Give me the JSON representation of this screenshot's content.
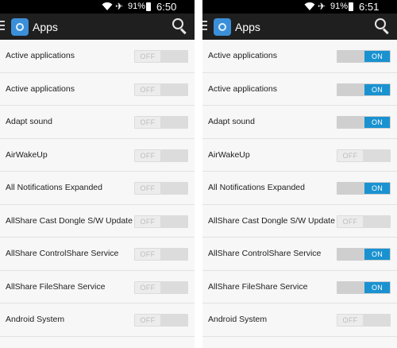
{
  "screens": [
    {
      "status": {
        "battery": "91%",
        "time": "6:50 PM"
      },
      "header": {
        "title": "Apps"
      },
      "apps": [
        {
          "name": "Active applications",
          "toggle": "OFF",
          "enabled": false
        },
        {
          "name": "Active applications",
          "toggle": "OFF",
          "enabled": false
        },
        {
          "name": "Adapt sound",
          "toggle": "OFF",
          "enabled": false
        },
        {
          "name": "AirWakeUp",
          "toggle": "OFF",
          "enabled": false
        },
        {
          "name": "All Notifications Expanded",
          "toggle": "OFF",
          "enabled": false
        },
        {
          "name": "AllShare Cast Dongle S/W Update",
          "toggle": "OFF",
          "enabled": false
        },
        {
          "name": "AllShare ControlShare Service",
          "toggle": "OFF",
          "enabled": false
        },
        {
          "name": "AllShare FileShare Service",
          "toggle": "OFF",
          "enabled": false
        },
        {
          "name": "Android System",
          "toggle": "OFF",
          "enabled": false
        }
      ]
    },
    {
      "status": {
        "battery": "91%",
        "time": "6:51 PM"
      },
      "header": {
        "title": "Apps"
      },
      "apps": [
        {
          "name": "Active applications",
          "toggle": "ON",
          "enabled": true
        },
        {
          "name": "Active applications",
          "toggle": "ON",
          "enabled": true
        },
        {
          "name": "Adapt sound",
          "toggle": "ON",
          "enabled": true
        },
        {
          "name": "AirWakeUp",
          "toggle": "OFF",
          "enabled": false
        },
        {
          "name": "All Notifications Expanded",
          "toggle": "ON",
          "enabled": true
        },
        {
          "name": "AllShare Cast Dongle S/W Update",
          "toggle": "OFF",
          "enabled": false
        },
        {
          "name": "AllShare ControlShare Service",
          "toggle": "ON",
          "enabled": true
        },
        {
          "name": "AllShare FileShare Service",
          "toggle": "ON",
          "enabled": true
        },
        {
          "name": "Android System",
          "toggle": "OFF",
          "enabled": false
        }
      ]
    }
  ],
  "colors": {
    "accent_on": "#1a92d0",
    "toggle_off": "#ececec",
    "actionbar": "#1f1f1f",
    "statusbar": "#000000"
  },
  "icons": {
    "status": [
      "wifi-icon",
      "airplane-mode-icon",
      "battery-icon"
    ],
    "actionbar": [
      "menu-icon",
      "apps-icon",
      "search-icon"
    ]
  }
}
